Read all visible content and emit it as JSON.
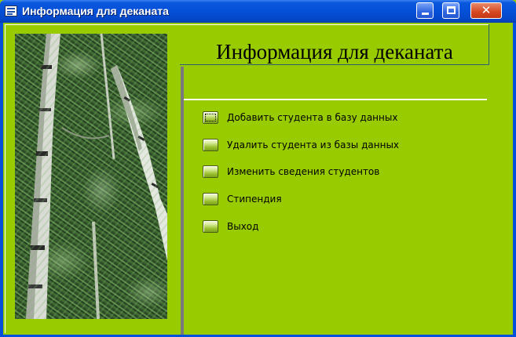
{
  "window": {
    "title": "Информация для деканата"
  },
  "form": {
    "heading": "Информация для деканата",
    "image_description": "birch-trees-photo"
  },
  "menu": {
    "items": [
      {
        "label": "Добавить студента в базу данных",
        "focused": true
      },
      {
        "label": "Удалить студента из базы данных",
        "focused": false
      },
      {
        "label": "Изменить сведения студентов",
        "focused": false
      },
      {
        "label": "Стипендия",
        "focused": false
      },
      {
        "label": "Выход",
        "focused": false
      }
    ]
  },
  "colors": {
    "background": "#99cc00",
    "titlebar": "#0550d8",
    "separator": "#7a7a7a"
  }
}
